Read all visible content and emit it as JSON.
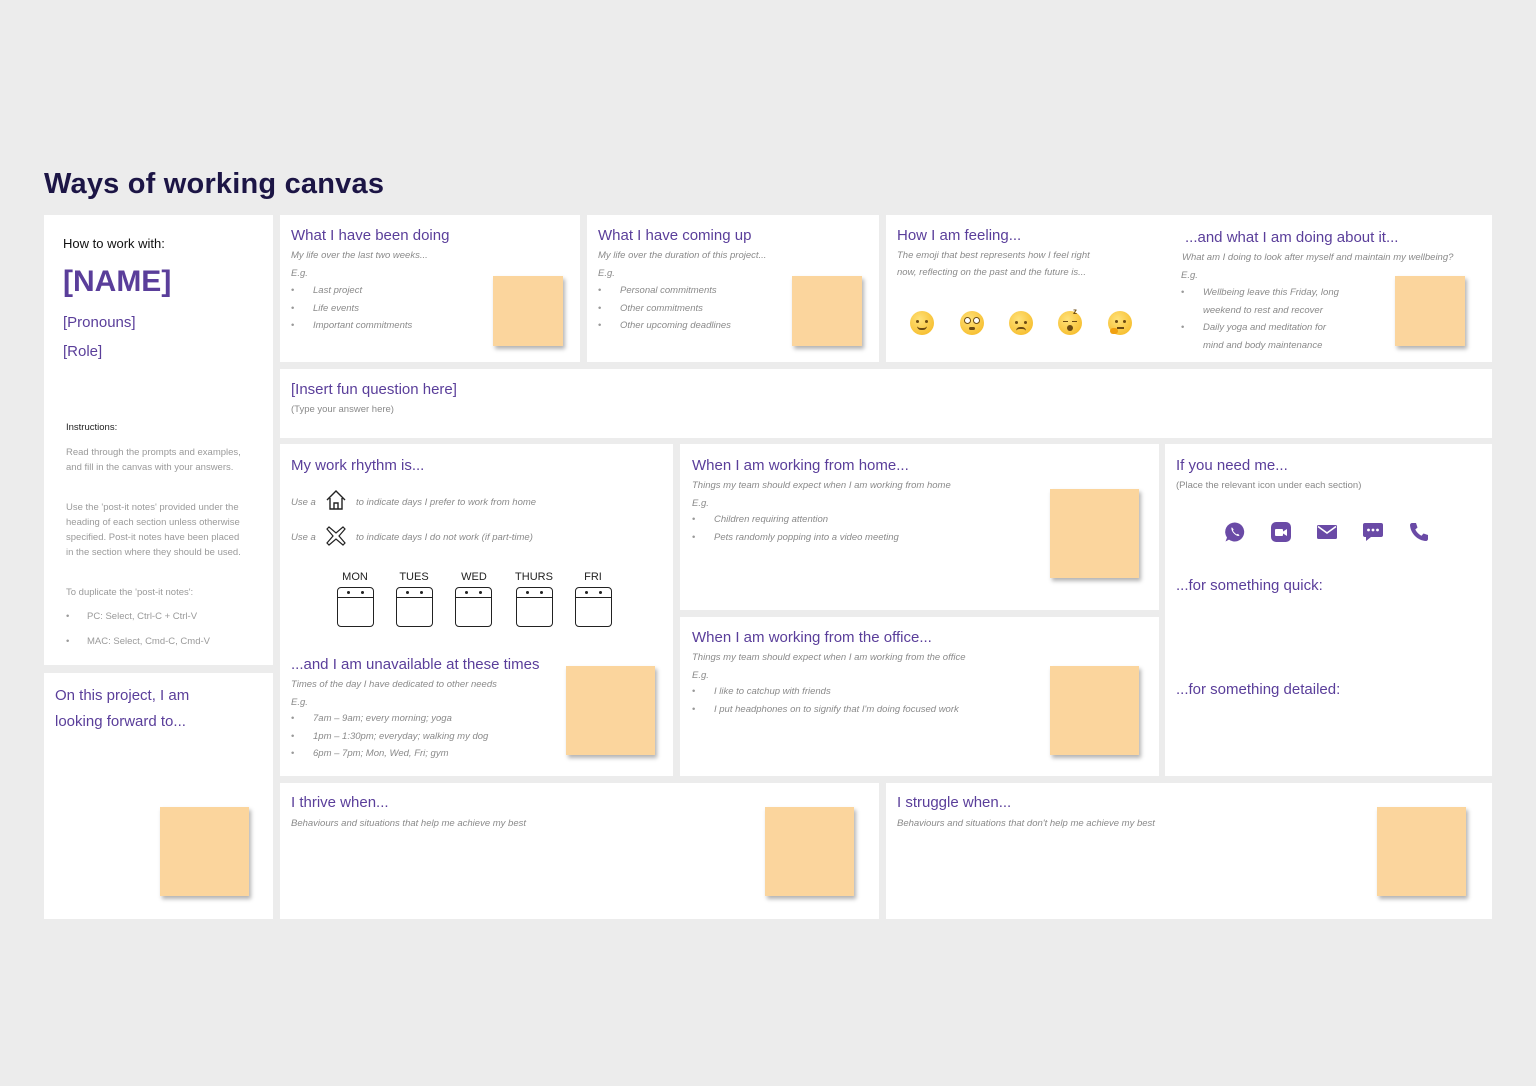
{
  "page_title": "Ways of working canvas",
  "profile": {
    "how_to": "How to work with:",
    "name": "[NAME]",
    "pronouns": "[Pronouns]",
    "role": "[Role]",
    "instructions_heading": "Instructions:",
    "instructions_p1": "Read through the prompts and examples, and fill in the canvas with your answers.",
    "instructions_p2": "Use the 'post-it notes' provided under the heading of each section unless otherwise specified. Post-it notes have been placed in the section where they should be used.",
    "instructions_p3": "To duplicate the 'post-it notes':",
    "instructions_bullets": [
      "PC: Select, Ctrl-C + Ctrl-V",
      "MAC: Select, Cmd-C, Cmd-V"
    ]
  },
  "forward": {
    "heading_line1": "On this project, I am",
    "heading_line2": "looking forward to..."
  },
  "doing": {
    "heading": "What I have been doing",
    "sub": "My life over the last two weeks...",
    "eg": "E.g.",
    "bullets": [
      "Last project",
      "Life events",
      "Important commitments"
    ]
  },
  "coming": {
    "heading": "What I have coming up",
    "sub": "My life over the duration of this project...",
    "eg": "E.g.",
    "bullets": [
      "Personal commitments",
      "Other commitments",
      "Other upcoming deadlines"
    ]
  },
  "feeling": {
    "heading": "How I am feeling...",
    "sub_line1": "The emoji that best represents how I feel right",
    "sub_line2": "now, reflecting on the past and the future is...",
    "emojis": [
      "relaxed-face-icon",
      "flushed-face-icon",
      "disappointed-face-icon",
      "sleeping-face-icon",
      "thinking-face-icon"
    ]
  },
  "wellbeing": {
    "heading": "...and what I am doing about it...",
    "sub": "What am I doing to look after myself and maintain my wellbeing?",
    "eg": "E.g.",
    "bullet1_line1": "Wellbeing leave this Friday, long",
    "bullet1_line2": "weekend to rest and recover",
    "bullet2_line1": "Daily yoga and meditation for",
    "bullet2_line2": "mind and body maintenance"
  },
  "fun": {
    "heading": "[Insert fun question here]",
    "sub": "(Type your answer here)"
  },
  "rhythm": {
    "heading": "My work rhythm is...",
    "use": "Use a",
    "home_text": "to indicate days I prefer to work from home",
    "off_text": "to indicate days I do not work (if part-time)",
    "days": [
      "MON",
      "TUES",
      "WED",
      "THURS",
      "FRI"
    ]
  },
  "unavailable": {
    "heading": "...and I am unavailable at these times",
    "sub": "Times of the day I have dedicated to other needs",
    "eg": "E.g.",
    "bullets": [
      "7am – 9am; every morning; yoga",
      "1pm – 1:30pm; everyday; walking my dog",
      "6pm – 7pm; Mon, Wed, Fri; gym"
    ]
  },
  "home": {
    "heading": "When I am working from home...",
    "sub": "Things my team should expect when I am working from home",
    "eg": "E.g.",
    "bullets": [
      "Children requiring attention",
      "Pets randomly popping into a video meeting"
    ]
  },
  "office": {
    "heading": "When I am working from the office...",
    "sub": "Things my team should expect when I am working from the office",
    "eg": "E.g.",
    "bullets": [
      "I like to catchup with friends",
      "I put headphones on to signify that I'm doing focused work"
    ]
  },
  "need": {
    "heading": "If you need me...",
    "sub": "(Place the relevant icon under each section)",
    "icons": [
      "whatsapp-icon",
      "video-call-icon",
      "email-icon",
      "chat-icon",
      "phone-icon"
    ],
    "quick": "...for something quick:",
    "detailed": "...for something detailed:"
  },
  "thrive": {
    "heading": "I thrive when...",
    "sub": "Behaviours and situations that help me achieve my best"
  },
  "struggle": {
    "heading": "I struggle when...",
    "sub": "Behaviours and situations that don't help me achieve my best"
  },
  "colors": {
    "accent": "#5a3e9a",
    "title": "#1c1545",
    "note": "#fbd59d",
    "background": "#ececec"
  }
}
